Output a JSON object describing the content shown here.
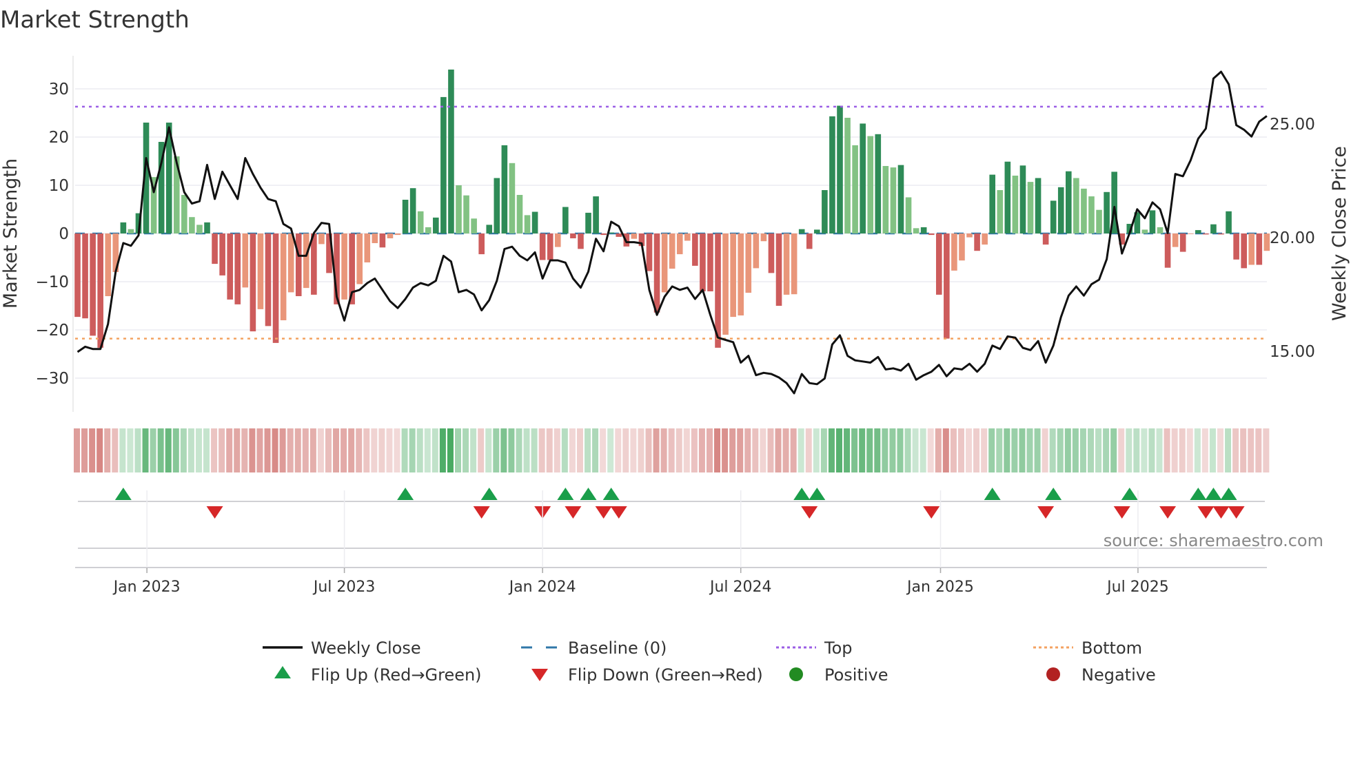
{
  "chart_data": {
    "type": "bar",
    "title": "Market Strength",
    "ylabel": "Market Strength",
    "ylabel_right": "Weekly Close Price",
    "ylim": [
      -37,
      37
    ],
    "y_ticks": [
      -30,
      -20,
      -10,
      0,
      10,
      20,
      30
    ],
    "y_tick_labels": [
      "−30",
      "−20",
      "−10",
      "0",
      "10",
      "20",
      "30"
    ],
    "right_ylim": [
      12.5,
      28
    ],
    "right_ticks": [
      15,
      20,
      25
    ],
    "right_tick_labels": [
      "15.00",
      "20.00",
      "25.00"
    ],
    "x_tick_labels": [
      "Jan 2023",
      "Jul 2023",
      "Jan 2024",
      "Jul 2024",
      "Jan 2025",
      "Jul 2025"
    ],
    "x_tick_week_index": [
      9.1,
      35,
      61,
      87,
      113.2,
      139.1
    ],
    "top_level": 26.3,
    "bottom_level": -21.8,
    "strength": [
      -17.3,
      -17.6,
      -21.2,
      -23.7,
      -13,
      -8,
      2.3,
      0.9,
      4.2,
      23,
      11.7,
      19,
      23,
      16,
      8,
      3.4,
      1.8,
      2.3,
      -6.3,
      -8.7,
      -13.7,
      -14.7,
      -11.2,
      -20.3,
      -15.7,
      -19.2,
      -22.7,
      -18,
      -12.2,
      -13,
      -11.3,
      -12.7,
      -2.2,
      -8.2,
      -14.7,
      -13.7,
      -14.7,
      -10.5,
      -6,
      -2,
      -2.9,
      -1,
      -0.3,
      7,
      9.4,
      4.6,
      1.3,
      3.3,
      28.3,
      34,
      10,
      7.9,
      3.1,
      -4.3,
      1.8,
      11.5,
      18.3,
      14.6,
      8,
      3.8,
      4.5,
      -5.5,
      -5.5,
      -2.8,
      5.5,
      -1,
      -3.2,
      4.3,
      7.7,
      -0.3,
      0.2,
      -0.7,
      -2.7,
      -1.1,
      -2.6,
      -7.8,
      -16.4,
      -12.2,
      -7.3,
      -4.3,
      -1.5,
      -6.7,
      -12,
      -12,
      -23.7,
      -21,
      -17.3,
      -17,
      -12.3,
      -7.2,
      -1.6,
      -8.2,
      -15,
      -12.7,
      -12.6,
      0.9,
      -3.2,
      0.8,
      9,
      24.3,
      26.5,
      24,
      18.3,
      22.8,
      20.2,
      20.6,
      14,
      13.7,
      14.2,
      7.5,
      1.1,
      1.3,
      -0.3,
      -12.7,
      -21.8,
      -7.7,
      -5.6,
      -0.8,
      -3.6,
      -2.3,
      12.2,
      9,
      14.9,
      12,
      14.1,
      10.7,
      11.5,
      -2.3,
      6.8,
      9.6,
      12.9,
      11.5,
      9.3,
      7.7,
      4.9,
      8.6,
      12.8,
      -2.3,
      2,
      4.4,
      0.8,
      4.8,
      1.3,
      -7.1,
      -2.8,
      -3.8,
      -0.1,
      0.7,
      -0.2,
      1.9,
      -0.2,
      4.6,
      -5.4,
      -7.2,
      -6.5,
      -6.5,
      -3.6
    ],
    "weekly_close": [
      14.97,
      15.2,
      15.1,
      15.1,
      16.2,
      18.5,
      19.76,
      19.64,
      20.1,
      23.5,
      22.0,
      23.3,
      24.85,
      23.3,
      22.0,
      21.5,
      21.6,
      23.2,
      21.7,
      22.9,
      22.3,
      21.7,
      23.5,
      22.8,
      22.2,
      21.7,
      21.6,
      20.6,
      20.4,
      19.2,
      19.2,
      20.2,
      20.65,
      20.6,
      17.4,
      16.35,
      17.6,
      17.7,
      18.0,
      18.2,
      17.7,
      17.2,
      16.9,
      17.3,
      17.8,
      18.0,
      17.9,
      18.1,
      19.2,
      18.95,
      17.6,
      17.7,
      17.5,
      16.8,
      17.25,
      18.1,
      19.5,
      19.6,
      19.2,
      19.0,
      19.35,
      18.2,
      19.0,
      19.0,
      18.9,
      18.2,
      17.8,
      18.5,
      19.95,
      19.4,
      20.7,
      20.5,
      19.8,
      19.8,
      19.75,
      17.7,
      16.6,
      17.4,
      17.85,
      17.7,
      17.8,
      17.3,
      17.7,
      16.6,
      15.6,
      15.5,
      15.4,
      14.5,
      14.8,
      13.95,
      14.05,
      14.0,
      13.85,
      13.6,
      13.15,
      14.0,
      13.6,
      13.55,
      13.8,
      15.3,
      15.7,
      14.8,
      14.6,
      14.55,
      14.5,
      14.75,
      14.2,
      14.25,
      14.15,
      14.45,
      13.75,
      13.95,
      14.1,
      14.4,
      13.9,
      14.25,
      14.2,
      14.45,
      14.1,
      14.45,
      15.25,
      15.1,
      15.65,
      15.6,
      15.15,
      15.05,
      15.45,
      14.5,
      15.25,
      16.5,
      17.45,
      17.85,
      17.45,
      17.95,
      18.15,
      19.05,
      21.35,
      19.3,
      20.2,
      21.25,
      20.85,
      21.55,
      21.25,
      20.2,
      22.8,
      22.7,
      23.4,
      24.35,
      24.8,
      27.0,
      27.3,
      26.75,
      24.95,
      24.75,
      24.45,
      25.1,
      25.35
    ],
    "flip_up_week_index": [
      6,
      43,
      54,
      64,
      67,
      70,
      95,
      97,
      120,
      128,
      138,
      147,
      149,
      151
    ],
    "flip_down_week_index": [
      18,
      53,
      61,
      65,
      69,
      71,
      96,
      112,
      127,
      137,
      143,
      148,
      150,
      152
    ],
    "legend": [
      {
        "label": "Weekly Close",
        "kind": "line"
      },
      {
        "label": "Baseline (0)",
        "kind": "dash"
      },
      {
        "label": "Top",
        "kind": "dot-top"
      },
      {
        "label": "Bottom",
        "kind": "dot-bottom"
      },
      {
        "label": "Flip Up (Red→Green)",
        "kind": "tri-up"
      },
      {
        "label": "Flip Down (Green→Red)",
        "kind": "tri-down"
      },
      {
        "label": "Positive",
        "kind": "circle-pos"
      },
      {
        "label": "Negative",
        "kind": "circle-neg"
      }
    ],
    "legend_placement": "bottom",
    "grid": true
  },
  "source_note": "source: sharemaestro.com",
  "colors": {
    "pos_strong": "#2e8b57",
    "pos_weak": "#82c283",
    "neg_strong": "#cd5c5c",
    "neg_weak": "#e9967a",
    "price_line": "#111111",
    "baseline": "#2f77a8",
    "top": "#9b5de5",
    "bottom": "#f4a261",
    "flip_up": "#1a9e4a",
    "flip_down": "#d62728",
    "positive": "#228b22",
    "negative": "#b22222"
  }
}
